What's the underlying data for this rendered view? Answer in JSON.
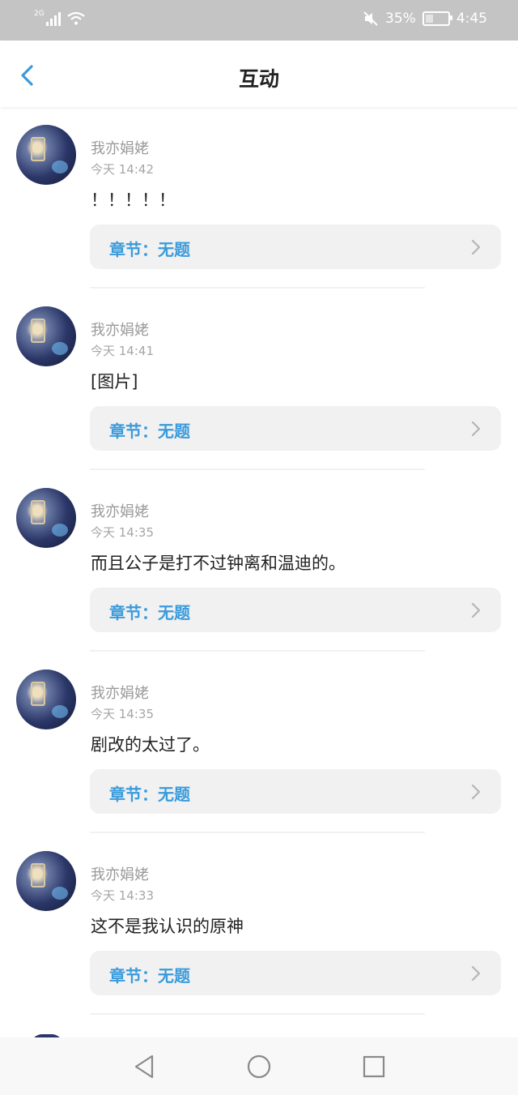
{
  "status_bar": {
    "network": "2G",
    "battery_percent": "35%",
    "time": "4:45",
    "battery_level": 0.35
  },
  "header": {
    "title": "互动"
  },
  "items": [
    {
      "username": "我亦娟姥",
      "time": "今天 14:42",
      "content": "！！！！！",
      "chapter": "章节：无题"
    },
    {
      "username": "我亦娟姥",
      "time": "今天 14:41",
      "content": "[图片]",
      "chapter": "章节：无题"
    },
    {
      "username": "我亦娟姥",
      "time": "今天 14:35",
      "content": "而且公子是打不过钟离和温迪的。",
      "chapter": "章节：无题"
    },
    {
      "username": "我亦娟姥",
      "time": "今天 14:35",
      "content": "剧改的太过了。",
      "chapter": "章节：无题"
    },
    {
      "username": "我亦娟姥",
      "time": "今天 14:33",
      "content": "这不是我认识的原神",
      "chapter": "章节：无题"
    }
  ],
  "colors": {
    "accent": "#3a9bdc",
    "status_bar_bg": "#c4c4c4",
    "chapter_bg": "#f1f1f1"
  },
  "icons": {
    "back": "chevron-left-icon",
    "chapter_arrow": "chevron-right-icon",
    "nav_back": "triangle-back-icon",
    "nav_home": "circle-home-icon",
    "nav_recent": "square-recent-icon"
  }
}
